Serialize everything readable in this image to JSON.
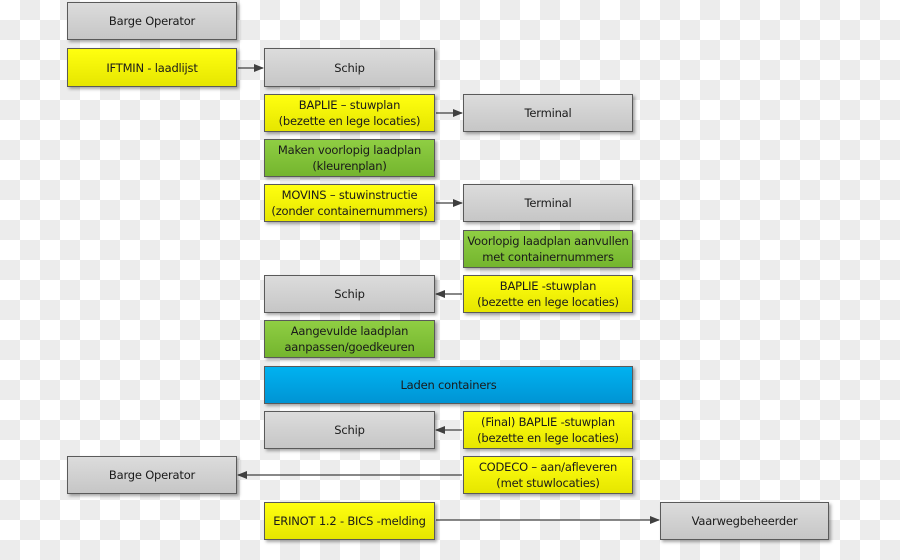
{
  "diagram": {
    "colors": {
      "actor": "#d0d0d0",
      "message": "#ffff00",
      "action": "#82c23a",
      "process": "#00a6e6",
      "connector": "#404040"
    },
    "boxes": [
      {
        "id": "barge-operator-1",
        "kind": "actor",
        "label": "Barge Operator"
      },
      {
        "id": "iftmin",
        "kind": "message",
        "label": "IFTMIN - laadlijst"
      },
      {
        "id": "schip-1",
        "kind": "actor",
        "label": "Schip"
      },
      {
        "id": "baplie-1",
        "kind": "message",
        "label": "BAPLIE – stuwplan\n(bezette en lege locaties)"
      },
      {
        "id": "terminal-1",
        "kind": "actor",
        "label": "Terminal"
      },
      {
        "id": "maken-laadplan",
        "kind": "action",
        "label": "Maken voorlopig laadplan\n(kleurenplan)"
      },
      {
        "id": "movins",
        "kind": "message",
        "label": "MOVINS – stuwinstructie\n(zonder containernummers)"
      },
      {
        "id": "terminal-2",
        "kind": "actor",
        "label": "Terminal"
      },
      {
        "id": "laadplan-aanvullen",
        "kind": "action",
        "label": "Voorlopig laadplan aanvullen\nmet containernummers"
      },
      {
        "id": "schip-2",
        "kind": "actor",
        "label": "Schip"
      },
      {
        "id": "baplie-2",
        "kind": "message",
        "label": "BAPLIE -stuwplan\n(bezette en lege locaties)"
      },
      {
        "id": "laadplan-aanpassen",
        "kind": "action",
        "label": "Aangevulde laadplan\naanpassen/goedkeuren"
      },
      {
        "id": "laden-containers",
        "kind": "process",
        "label": "Laden containers"
      },
      {
        "id": "schip-3",
        "kind": "actor",
        "label": "Schip"
      },
      {
        "id": "baplie-final",
        "kind": "message",
        "label": "(Final) BAPLIE -stuwplan\n(bezette en lege locaties)"
      },
      {
        "id": "barge-operator-2",
        "kind": "actor",
        "label": "Barge Operator"
      },
      {
        "id": "codeco",
        "kind": "message",
        "label": "CODECO – aan/afleveren\n(met stuwlocaties)"
      },
      {
        "id": "erinot",
        "kind": "message",
        "label": "ERINOT 1.2 - BICS -melding"
      },
      {
        "id": "vaarwegbeheerder",
        "kind": "actor",
        "label": "Vaarwegbeheerder"
      }
    ],
    "arrows": [
      {
        "from": "iftmin",
        "to": "schip-1",
        "direction": "right"
      },
      {
        "from": "baplie-1",
        "to": "terminal-1",
        "direction": "right"
      },
      {
        "from": "movins",
        "to": "terminal-2",
        "direction": "right"
      },
      {
        "from": "baplie-2",
        "to": "schip-2",
        "direction": "left"
      },
      {
        "from": "baplie-final",
        "to": "schip-3",
        "direction": "left"
      },
      {
        "from": "codeco",
        "to": "barge-operator-2",
        "direction": "left"
      },
      {
        "from": "erinot",
        "to": "vaarwegbeheerder",
        "direction": "right"
      }
    ]
  }
}
